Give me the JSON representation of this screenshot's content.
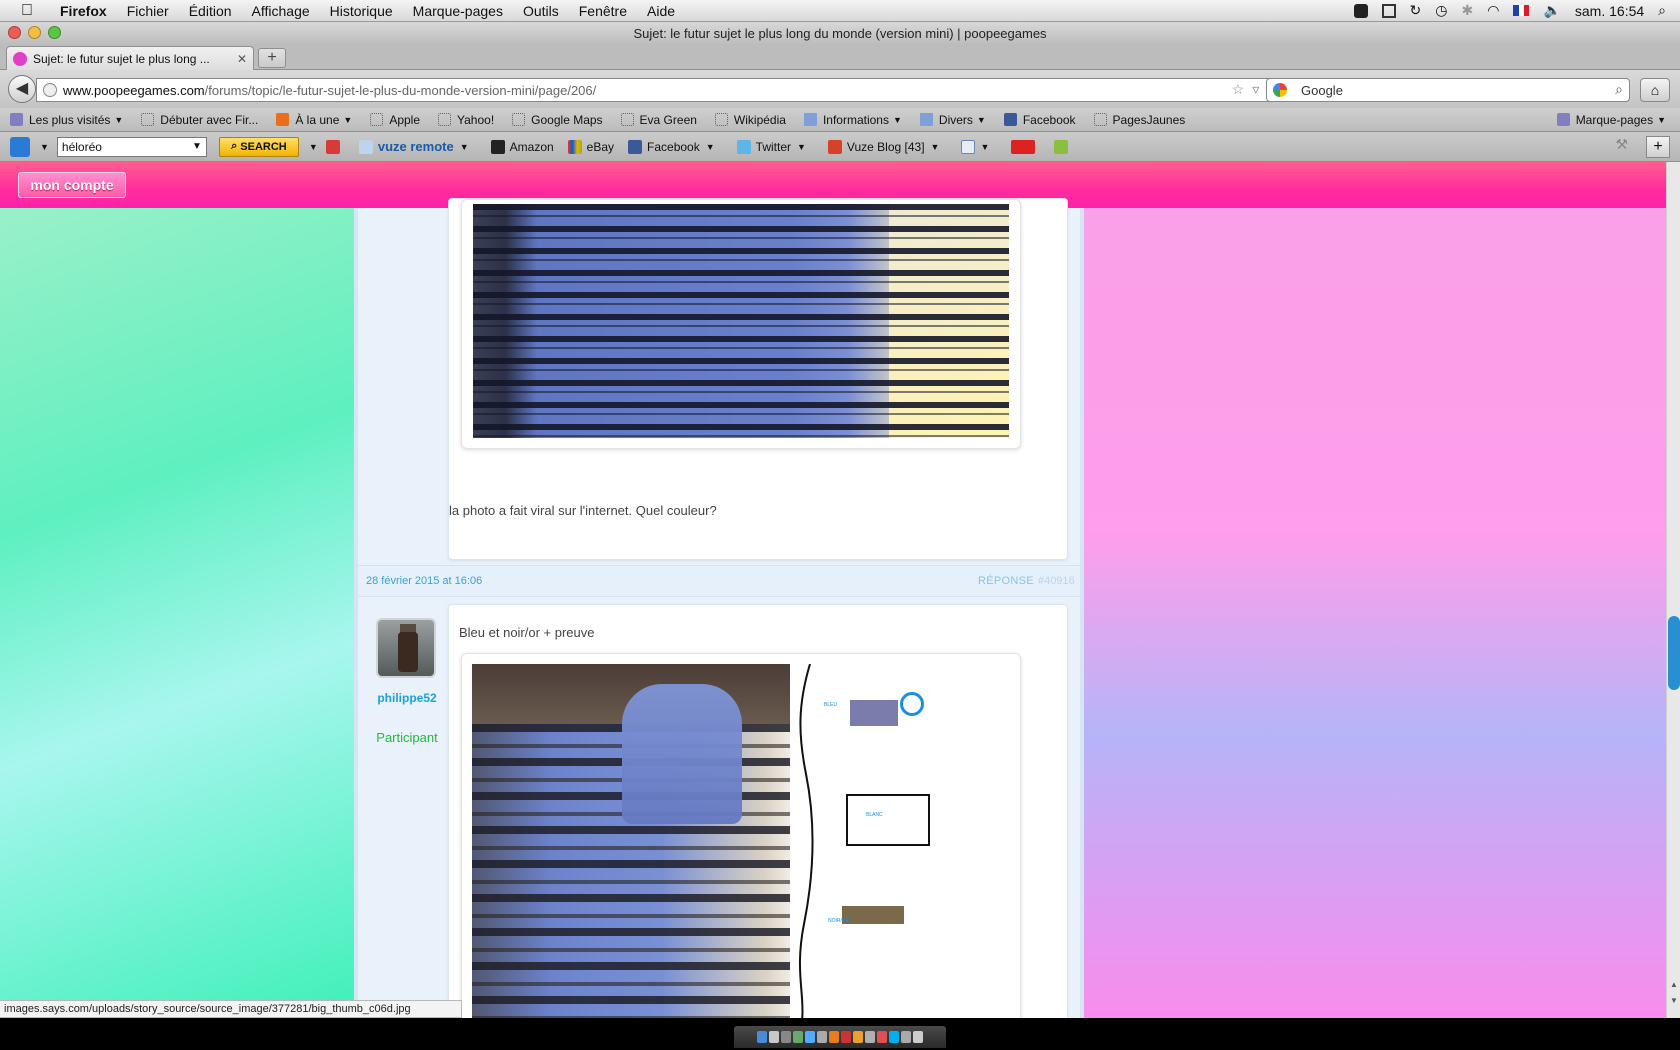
{
  "os_menubar": {
    "app_name": "Firefox",
    "menus": [
      "Fichier",
      "Édition",
      "Affichage",
      "Historique",
      "Marque-pages",
      "Outils",
      "Fenêtre",
      "Aide"
    ],
    "clock": "sam. 16:54"
  },
  "window": {
    "title": "Sujet: le futur sujet le plus long du monde (version mini) | poopeegames"
  },
  "tabs": [
    {
      "label": "Sujet: le futur sujet le plus long ...",
      "active": true
    }
  ],
  "new_tab_label": "+",
  "navbar": {
    "url_host": "www.poopeegames.com",
    "url_path": "/forums/topic/le-futur-sujet-le-plus-du-monde-version-mini/page/206/",
    "search_engine": "Google"
  },
  "bookmarks": [
    {
      "label": "Les plus visités",
      "dropdown": true,
      "icon": "plain"
    },
    {
      "label": "Débuter avec Fir...",
      "dropdown": false,
      "icon": "page"
    },
    {
      "label": "À la une",
      "dropdown": true,
      "icon": "rss"
    },
    {
      "label": "Apple",
      "dropdown": false,
      "icon": "page"
    },
    {
      "label": "Yahoo!",
      "dropdown": false,
      "icon": "page"
    },
    {
      "label": "Google Maps",
      "dropdown": false,
      "icon": "page"
    },
    {
      "label": "Eva Green",
      "dropdown": false,
      "icon": "page"
    },
    {
      "label": "Wikipédia",
      "dropdown": false,
      "icon": "page"
    },
    {
      "label": "Informations",
      "dropdown": true,
      "icon": "folder"
    },
    {
      "label": "Divers",
      "dropdown": true,
      "icon": "folder"
    },
    {
      "label": "Facebook",
      "dropdown": false,
      "icon": "fb"
    },
    {
      "label": "PagesJaunes",
      "dropdown": false,
      "icon": "page"
    }
  ],
  "bookmarks_menu_label": "Marque-pages",
  "addon_toolbar": {
    "search_value": "héloréo",
    "search_button": "SEARCH",
    "vuze_label": "vuze remote",
    "items": [
      "Amazon",
      "eBay",
      "Facebook",
      "Twitter",
      "Vuze Blog [43]"
    ]
  },
  "site": {
    "account_button": "mon compte"
  },
  "post1": {
    "caption": "la photo a fait viral sur l'internet. Quel couleur?"
  },
  "reply_meta": {
    "date": "28 février 2015 at 16:06",
    "reply_label": "RÉPONSE",
    "post_number": "#40916"
  },
  "post2": {
    "author": "philippe52",
    "role": "Participant",
    "text": "Bleu et noir/or + preuve",
    "swatch_labels": {
      "blue": "BLEU",
      "white": "BLANC",
      "gold": "NOIR/OR"
    }
  },
  "status_bar": {
    "text": "images.says.com/uploads/story_source/source_image/377281/big_thumb_c06d.jpg"
  },
  "colors": {
    "header_pink": "#ff2c9a",
    "link_blue": "#1ea0e0",
    "role_green": "#22bb3a",
    "scroll_thumb": "#2a8fd0"
  }
}
